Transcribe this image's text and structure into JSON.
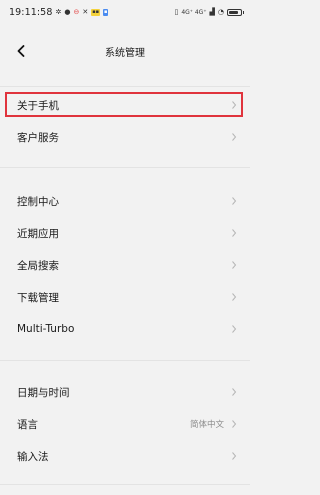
{
  "status_bar": {
    "time": "19:11:58",
    "left_icons": [
      "gear-icon",
      "notification-dot-icon",
      "no-entry-icon",
      "tools-icon",
      "app-badge-icon",
      "app-badge-icon"
    ],
    "right_text": "4G⁺ 4G⁺",
    "battery_level": 0.8
  },
  "header": {
    "title": "系统管理",
    "back_icon": "back-arrow-icon"
  },
  "groups": [
    {
      "items": [
        {
          "label": "关于手机",
          "highlighted": true
        },
        {
          "label": "客户服务"
        }
      ]
    },
    {
      "items": [
        {
          "label": "控制中心"
        },
        {
          "label": "近期应用"
        },
        {
          "label": "全局搜索"
        },
        {
          "label": "下载管理"
        },
        {
          "label": "Multi-Turbo"
        }
      ]
    },
    {
      "items": [
        {
          "label": "日期与时间"
        },
        {
          "label": "语言",
          "value": "简体中文"
        },
        {
          "label": "输入法"
        }
      ]
    }
  ],
  "colors": {
    "background": "#f2f2f2",
    "highlight": "#e0343d",
    "chevron": "#b5b5b5"
  }
}
